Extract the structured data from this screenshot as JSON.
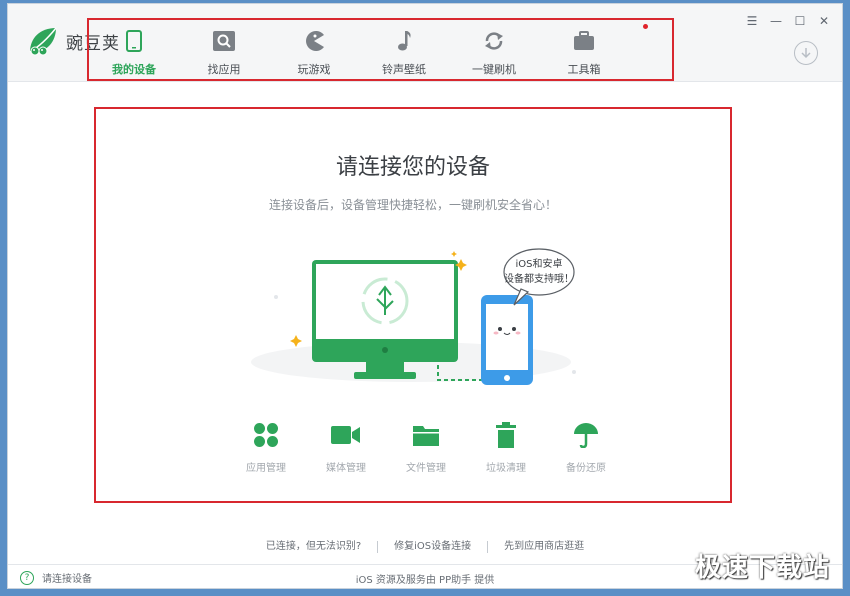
{
  "app": {
    "name": "豌豆荚",
    "brand_color": "#2ea55a"
  },
  "nav": {
    "items": [
      {
        "label": "我的设备",
        "icon": "phone-icon",
        "active": true
      },
      {
        "label": "找应用",
        "icon": "app-search-icon",
        "active": false
      },
      {
        "label": "玩游戏",
        "icon": "pacman-icon",
        "active": false
      },
      {
        "label": "铃声壁纸",
        "icon": "music-note-icon",
        "active": false
      },
      {
        "label": "一键刷机",
        "icon": "refresh-icon",
        "active": false
      },
      {
        "label": "工具箱",
        "icon": "toolbox-icon",
        "active": false
      }
    ]
  },
  "window_controls": {
    "menu": "☰",
    "minimize": "—",
    "maximize": "☐",
    "close": "✕"
  },
  "main": {
    "title": "请连接您的设备",
    "subtitle": "连接设备后，设备管理快捷轻松，一键刷机安全省心！",
    "bubble_line1": "iOS和安卓",
    "bubble_line2": "设备都支持哦！"
  },
  "features": [
    {
      "label": "应用管理",
      "icon": "grid-icon"
    },
    {
      "label": "媒体管理",
      "icon": "video-icon"
    },
    {
      "label": "文件管理",
      "icon": "folder-icon"
    },
    {
      "label": "垃圾清理",
      "icon": "trash-icon"
    },
    {
      "label": "备份还原",
      "icon": "umbrella-icon"
    }
  ],
  "links": [
    {
      "label": "已连接，但无法识别?"
    },
    {
      "label": "修复iOS设备连接"
    },
    {
      "label": "先到应用商店逛逛"
    }
  ],
  "status": {
    "help_symbol": "?",
    "left_text": "请连接设备",
    "center_text": "iOS 资源及服务由 PP助手 提供"
  },
  "watermark": "极速下载站"
}
